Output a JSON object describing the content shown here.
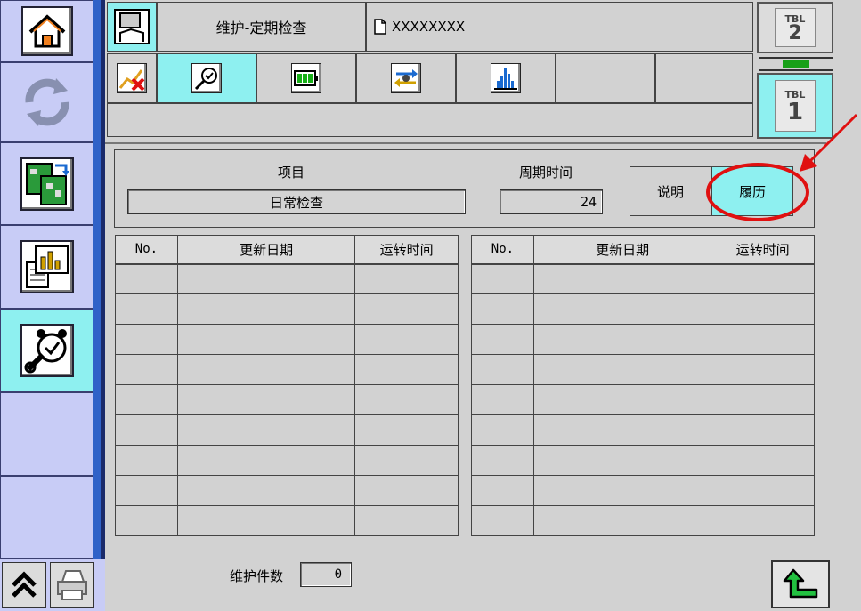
{
  "header": {
    "screen_title": "维护-定期检查",
    "file_name": "XXXXXXXX",
    "tbl_top": {
      "label": "TBL",
      "number": "2"
    },
    "tbl_bottom": {
      "label": "TBL",
      "number": "1"
    }
  },
  "sidebar": {
    "icons": [
      "home-icon",
      "recycle-icon",
      "circuit-board-icon",
      "report-chart-icon",
      "maintenance-alarm-icon"
    ],
    "bottom": [
      "double-chevron-up-icon",
      "printer-icon"
    ]
  },
  "toolbar": {
    "tabs": [
      "trend-error-icon",
      "maintenance-alarm-icon",
      "battery-icon",
      "transfer-icon",
      "histogram-icon"
    ]
  },
  "info": {
    "item_label": "项目",
    "item_value": "日常检查",
    "cycle_label": "周期时间",
    "cycle_value": "24",
    "explain_button": "说明",
    "history_button": "履历"
  },
  "table_left": {
    "headers": [
      "No.",
      "更新日期",
      "运转时间"
    ],
    "rows": 9
  },
  "table_right": {
    "headers": [
      "No.",
      "更新日期",
      "运转时间"
    ],
    "rows": 9
  },
  "footer": {
    "count_label": "维护件数",
    "count_value": "0"
  },
  "colors": {
    "sidebar_bg": "#c8ccf6",
    "active_bg": "#8ef0f0",
    "panel_bg": "#d2d2d2",
    "annotation": "#e01010"
  }
}
